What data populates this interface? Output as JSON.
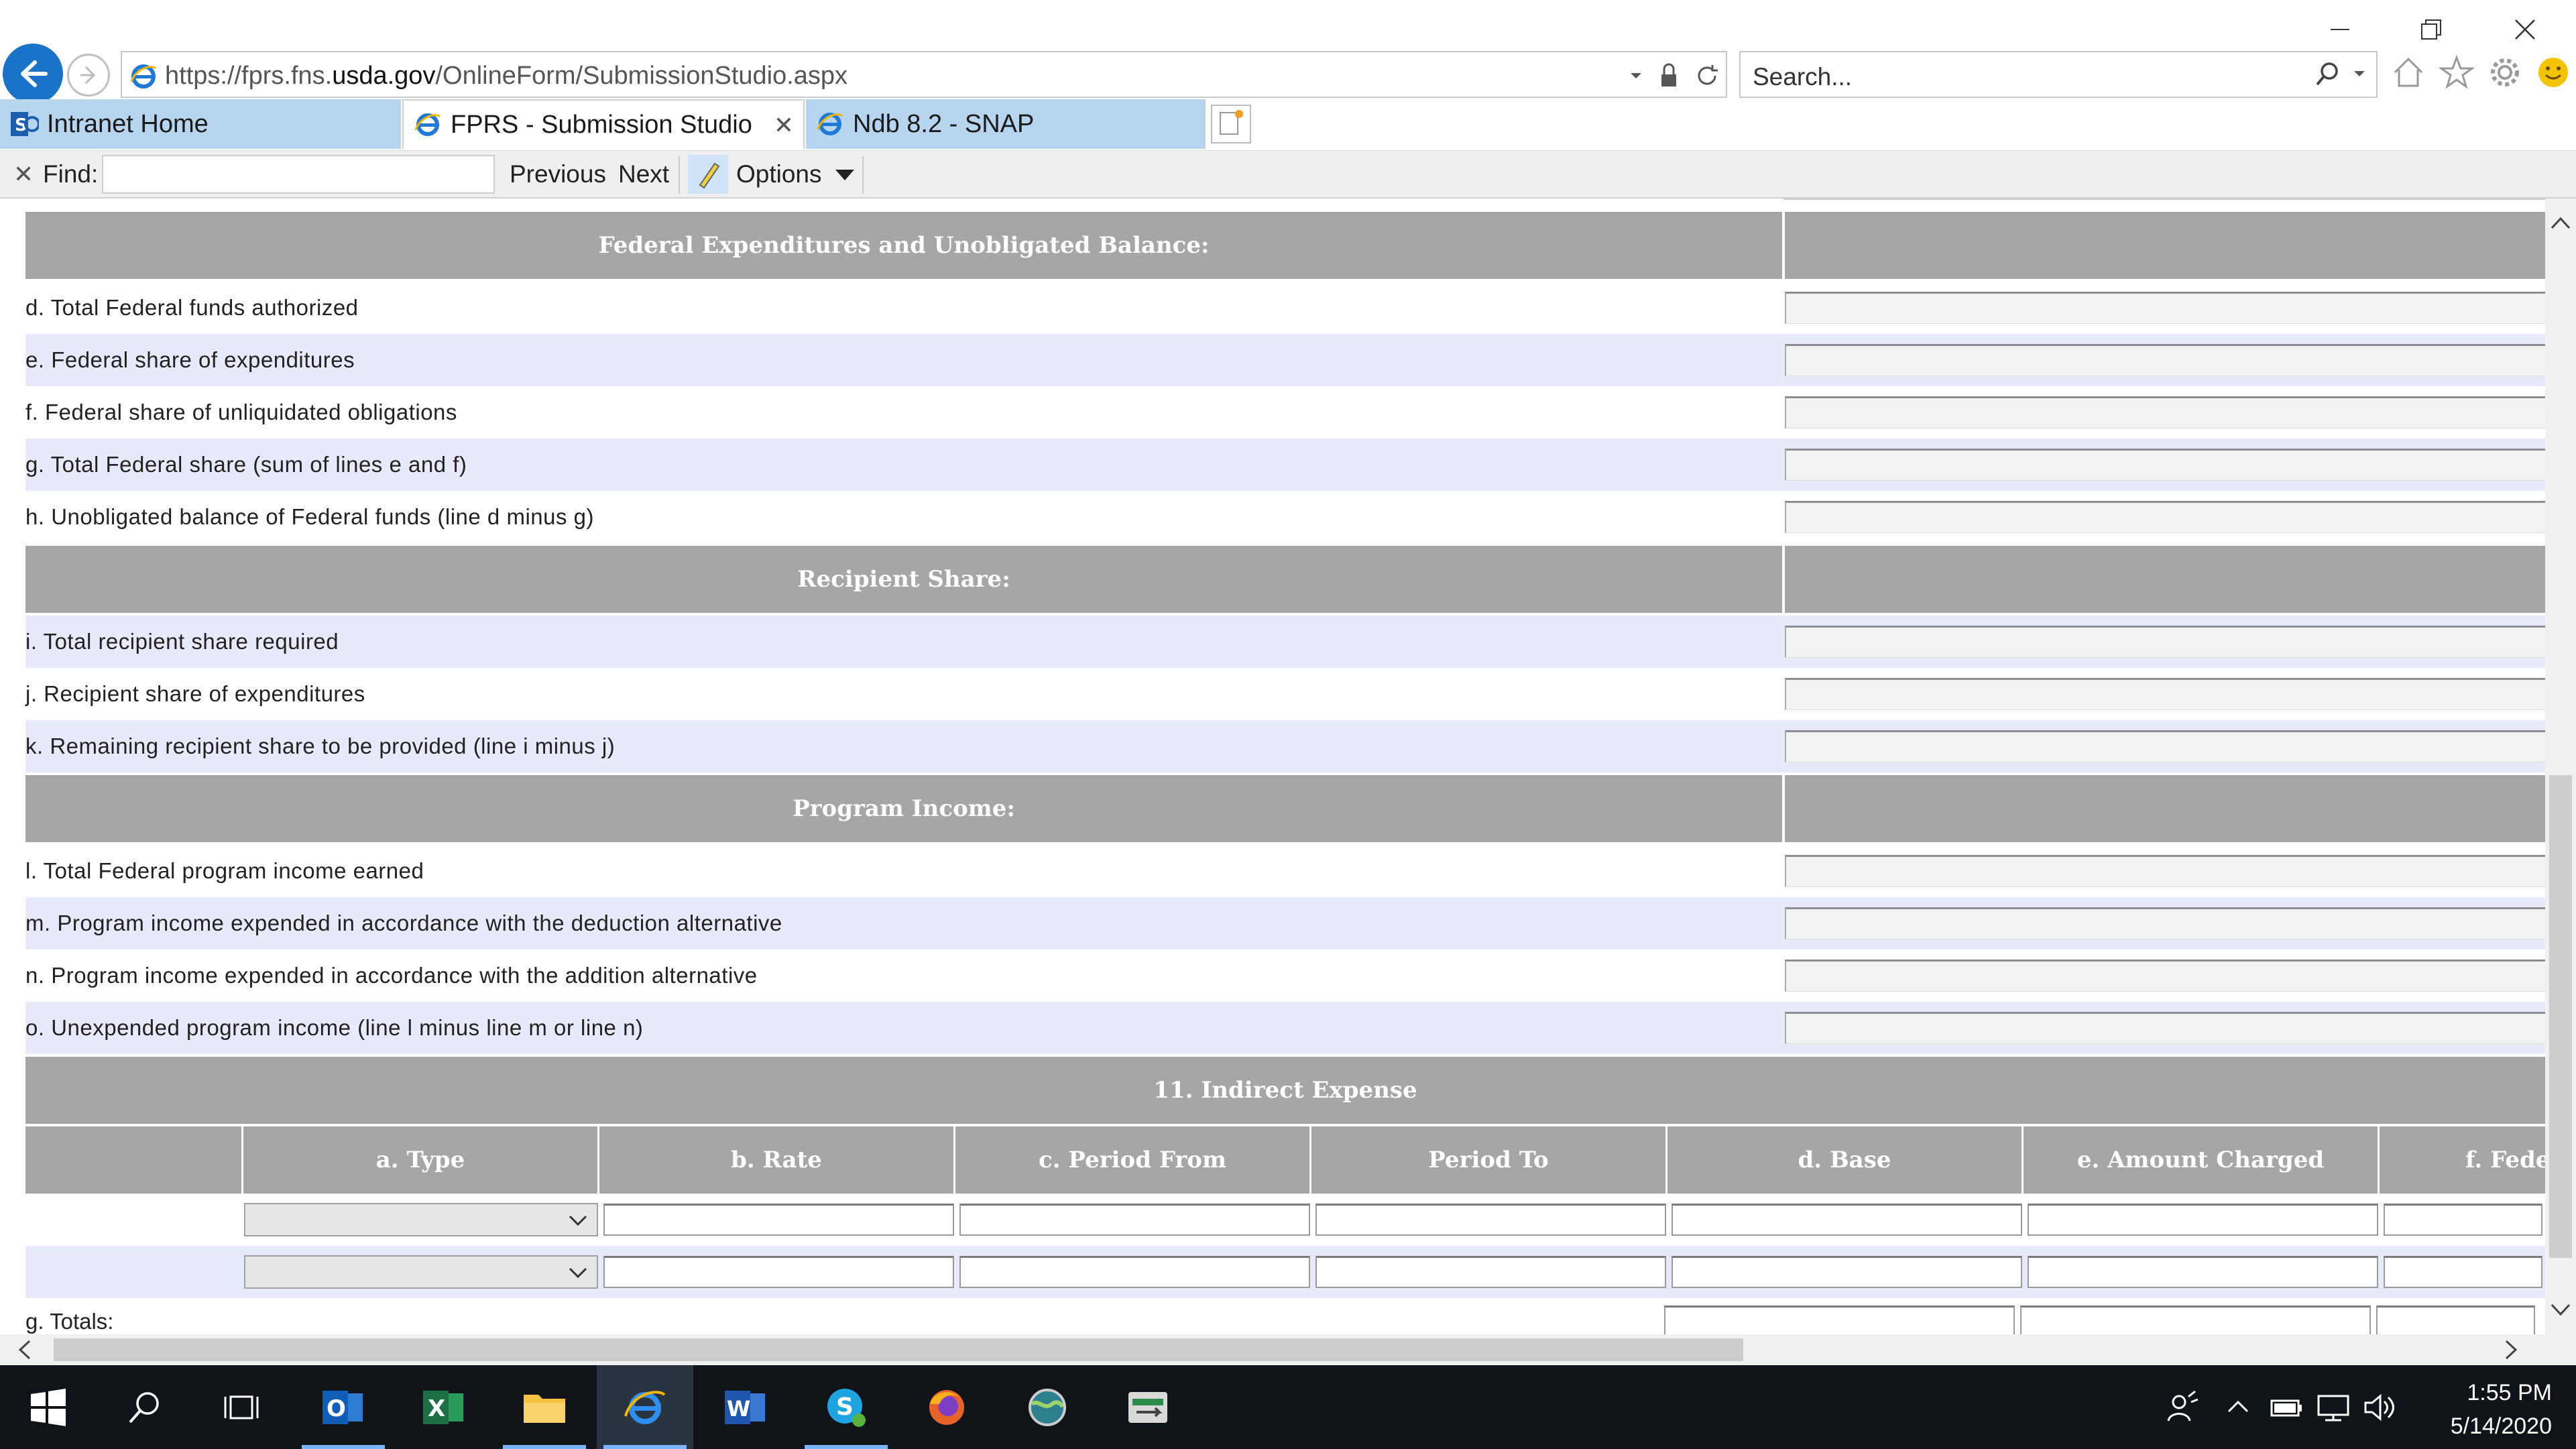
{
  "browser": {
    "url": "https://fprs.fns.usda.gov/OnlineForm/SubmissionStudio.aspx",
    "search_placeholder": "Search...",
    "tabs": [
      {
        "label": "Intranet Home",
        "icon": "sharepoint-icon",
        "active": false
      },
      {
        "label": "FPRS - Submission Studio",
        "icon": "ie-icon",
        "active": true
      },
      {
        "label": "Ndb 8.2 - SNAP",
        "icon": "ie-icon",
        "active": false
      }
    ],
    "find": {
      "label": "Find:",
      "value": "",
      "previous": "Previous",
      "next": "Next",
      "options": "Options"
    }
  },
  "form": {
    "sections": [
      {
        "title": "Federal Expenditures and Unobligated Balance:",
        "rows": [
          {
            "label": "d. Total Federal funds authorized",
            "value": ""
          },
          {
            "label": "e. Federal share of expenditures",
            "value": ""
          },
          {
            "label": "f. Federal share of unliquidated obligations",
            "value": ""
          },
          {
            "label": "g. Total Federal share (sum of lines e and f)",
            "value": ""
          },
          {
            "label": "h. Unobligated balance of Federal funds (line d minus g)",
            "value": ""
          }
        ]
      },
      {
        "title": "Recipient Share:",
        "rows": [
          {
            "label": "i. Total recipient share required",
            "value": ""
          },
          {
            "label": "j. Recipient share of expenditures",
            "value": ""
          },
          {
            "label": "k. Remaining recipient share to be provided (line i minus j)",
            "value": ""
          }
        ]
      },
      {
        "title": "Program Income:",
        "rows": [
          {
            "label": "l. Total Federal program income earned",
            "value": ""
          },
          {
            "label": "m. Program income expended in accordance with the deduction alternative",
            "value": ""
          },
          {
            "label": "n. Program income expended in accordance with the addition alternative",
            "value": ""
          },
          {
            "label": "o. Unexpended program income (line l minus line m or line n)",
            "value": ""
          }
        ]
      }
    ],
    "indirect_expense": {
      "title": "11. Indirect Expense",
      "columns": [
        "",
        "a. Type",
        "b. Rate",
        "c. Period From",
        "Period To",
        "d. Base",
        "e. Amount Charged",
        "f. Fede"
      ],
      "totals_label": "g. Totals:"
    }
  },
  "taskbar": {
    "apps": [
      "start-icon",
      "search-icon",
      "task-view-icon",
      "outlook-icon",
      "excel-icon",
      "file-explorer-icon",
      "internet-explorer-icon",
      "word-icon",
      "skype-icon",
      "firefox-icon",
      "globe-app-icon",
      "scanner-app-icon"
    ],
    "time": "1:55 PM",
    "date": "5/14/2020"
  },
  "colors": {
    "section_header": "#a6a6a6",
    "alt_row": "#e8e9fb",
    "tab_inactive": "#b7d5ee",
    "back_button": "#1a73c8",
    "taskbar": "#101418"
  }
}
